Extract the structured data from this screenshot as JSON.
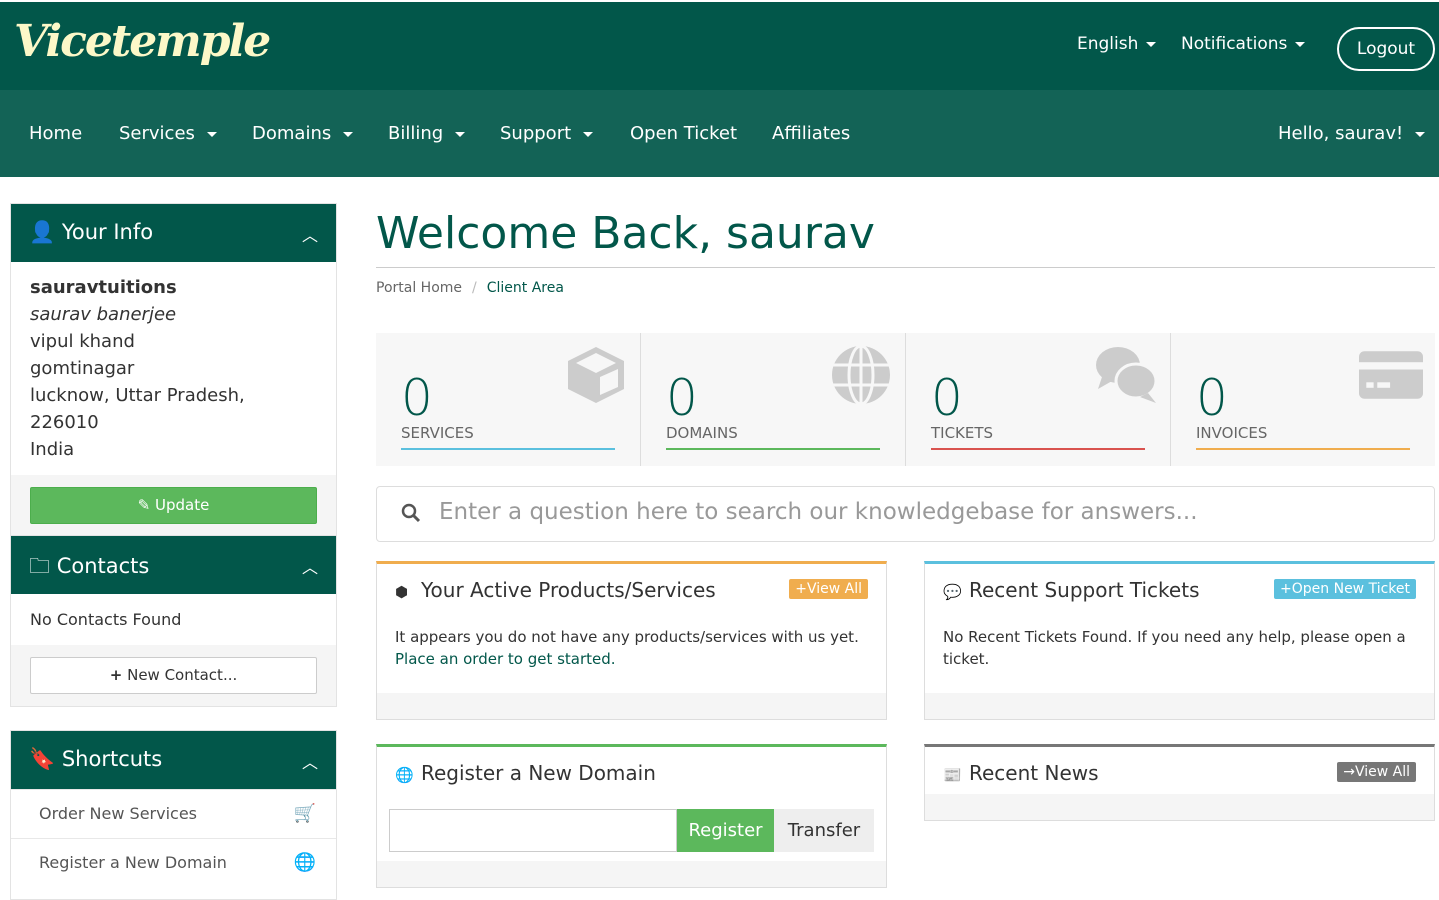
{
  "brand": {
    "logo": "Vicetemple"
  },
  "topbar": {
    "language": "English",
    "notifications": "Notifications",
    "logout": "Logout"
  },
  "nav": {
    "items": [
      "Home",
      "Services",
      "Domains",
      "Billing",
      "Support",
      "Open Ticket",
      "Affiliates"
    ],
    "user": "Hello, saurav!"
  },
  "your_info": {
    "title": "Your Info",
    "username": "sauravtuitions",
    "fullname": "saurav banerjee",
    "address1": "vipul khand",
    "address2": "gomtinagar",
    "city_line": "lucknow, Uttar Pradesh, 226010",
    "country": "India",
    "update": "Update"
  },
  "contacts": {
    "title": "Contacts",
    "empty": "No Contacts Found",
    "new": "New Contact..."
  },
  "shortcuts": {
    "title": "Shortcuts",
    "items": [
      "Order New Services",
      "Register a New Domain"
    ]
  },
  "page": {
    "title": "Welcome Back, saurav",
    "breadcrumb": [
      "Portal Home",
      "Client Area"
    ]
  },
  "tiles": [
    {
      "value": "0",
      "label": "SERVICES",
      "color": "#5bc0de"
    },
    {
      "value": "0",
      "label": "DOMAINS",
      "color": "#5cb85c"
    },
    {
      "value": "0",
      "label": "TICKETS",
      "color": "#d9534f"
    },
    {
      "value": "0",
      "label": "INVOICES",
      "color": "#f0ad4e"
    }
  ],
  "search": {
    "placeholder": "Enter a question here to search our knowledgebase for answers..."
  },
  "products": {
    "title": "Your Active Products/Services",
    "button": "View All",
    "text": "It appears you do not have any products/services with us yet.",
    "link": "Place an order to get started."
  },
  "tickets": {
    "title": "Recent Support Tickets",
    "button": "Open New Ticket",
    "text": "No Recent Tickets Found. If you need any help, please open a ticket."
  },
  "domain": {
    "title": "Register a New Domain",
    "register": "Register",
    "transfer": "Transfer"
  },
  "news": {
    "title": "Recent News",
    "button": "View All"
  }
}
